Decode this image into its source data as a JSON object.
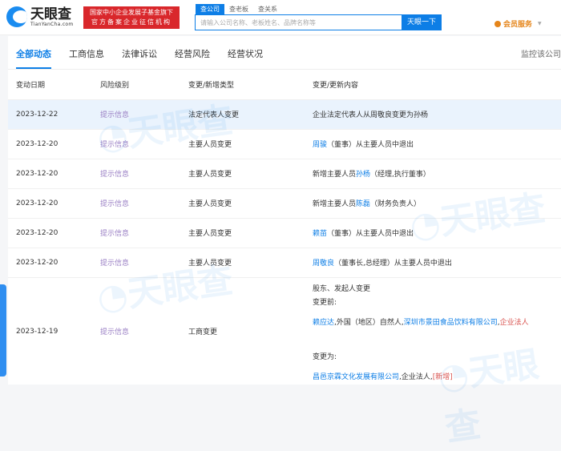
{
  "header": {
    "logo_cn": "天眼查",
    "logo_en": "TianYanCha.com",
    "badge_line1": "国家中小企业发展子基金旗下",
    "badge_line2": "官方备案企业征信机构",
    "search_tabs": [
      "查公司",
      "查老板",
      "查关系"
    ],
    "search_placeholder": "请输入公司名称、老板姓名、品牌名称等",
    "search_button": "天眼一下",
    "vip": "会员服务"
  },
  "tabs": [
    "全部动态",
    "工商信息",
    "法律诉讼",
    "经营风险",
    "经营状况"
  ],
  "monitor": "监控该公司",
  "columns": [
    "变动日期",
    "风险级别",
    "变更/新增类型",
    "变更/更新内容"
  ],
  "rows": [
    {
      "date": "2023-12-22",
      "risk": "提示信息",
      "type": "法定代表人变更",
      "pre": "企业法定代表人从周敬良变更为孙杨",
      "name": "",
      "post": ""
    },
    {
      "date": "2023-12-20",
      "risk": "提示信息",
      "type": "主要人员变更",
      "pre": "",
      "name": "周骏",
      "post": "（董事）从主要人员中退出"
    },
    {
      "date": "2023-12-20",
      "risk": "提示信息",
      "type": "主要人员变更",
      "pre": "新增主要人员",
      "name": "孙杨",
      "post": "（经理,执行董事）"
    },
    {
      "date": "2023-12-20",
      "risk": "提示信息",
      "type": "主要人员变更",
      "pre": "新增主要人员",
      "name": "陈磊",
      "post": "（财务负责人）"
    },
    {
      "date": "2023-12-20",
      "risk": "提示信息",
      "type": "主要人员变更",
      "pre": "",
      "name": "赖苗",
      "post": "（董事）从主要人员中退出"
    },
    {
      "date": "2023-12-20",
      "risk": "提示信息",
      "type": "主要人员变更",
      "pre": "",
      "name": "周敬良",
      "post": "（董事长,总经理）从主要人员中退出"
    }
  ],
  "big_row": {
    "date": "2023-12-19",
    "risk": "提示信息",
    "type": "工商变更",
    "title": "股东、发起人变更",
    "before_label": "变更前:",
    "before": {
      "p1": "赖应达",
      "t1": ",外国（地区）自然人,",
      "p2": "深圳市景田食品饮料有限公司",
      "t2": ",",
      "tag": "企业法人"
    },
    "after_label": "变更为:",
    "after": {
      "p1": "昌邑京霖文化发展有限公司",
      "t1": ",企业法人,",
      "tag": "[新增]"
    }
  }
}
